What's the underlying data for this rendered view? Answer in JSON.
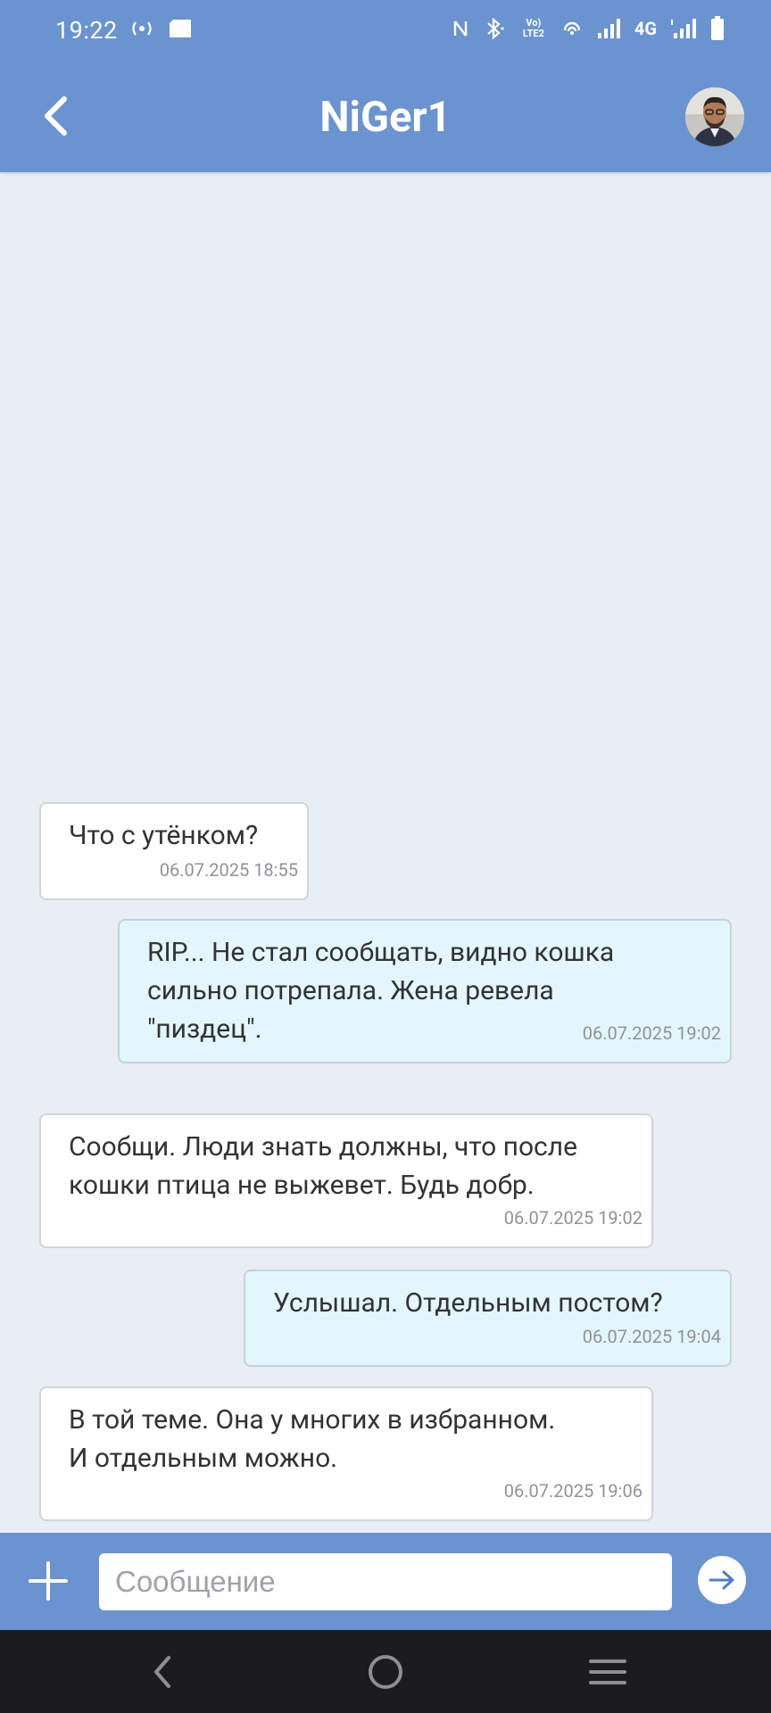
{
  "status_bar": {
    "time": "19:22",
    "network": "4G",
    "volte_label": "Vo) LTE2"
  },
  "header": {
    "title": "NiGer1",
    "back_icon": "chevron-left-icon",
    "avatar_icon": "user-avatar"
  },
  "messages": [
    {
      "direction": "in",
      "text": "Что с утёнком?",
      "time": "06.07.2025 18:55"
    },
    {
      "direction": "out",
      "text": "RIP... Не стал сообщать, видно кошка\nсильно потрепала. Жена ревела\n\"пиздец\".",
      "time": "06.07.2025 19:02"
    },
    {
      "direction": "in",
      "text": "Сообщи. Люди знать должны, что после\nкошки птица не выжевет. Будь добр.",
      "time": "06.07.2025 19:02"
    },
    {
      "direction": "out",
      "text": "Услышал. Отдельным постом?",
      "time": "06.07.2025 19:04"
    },
    {
      "direction": "in",
      "text": "В той теме. Она у многих в избранном.\nИ отдельным можно.",
      "time": "06.07.2025 19:06"
    }
  ],
  "composer": {
    "placeholder": "Сообщение",
    "value": ""
  },
  "colors": {
    "header_bg": "#6b93cf",
    "incoming_bg": "#ffffff",
    "outgoing_bg": "#e3f6fd",
    "chat_bg": "#e9edf4",
    "nav_bg": "#1c1c1e"
  }
}
